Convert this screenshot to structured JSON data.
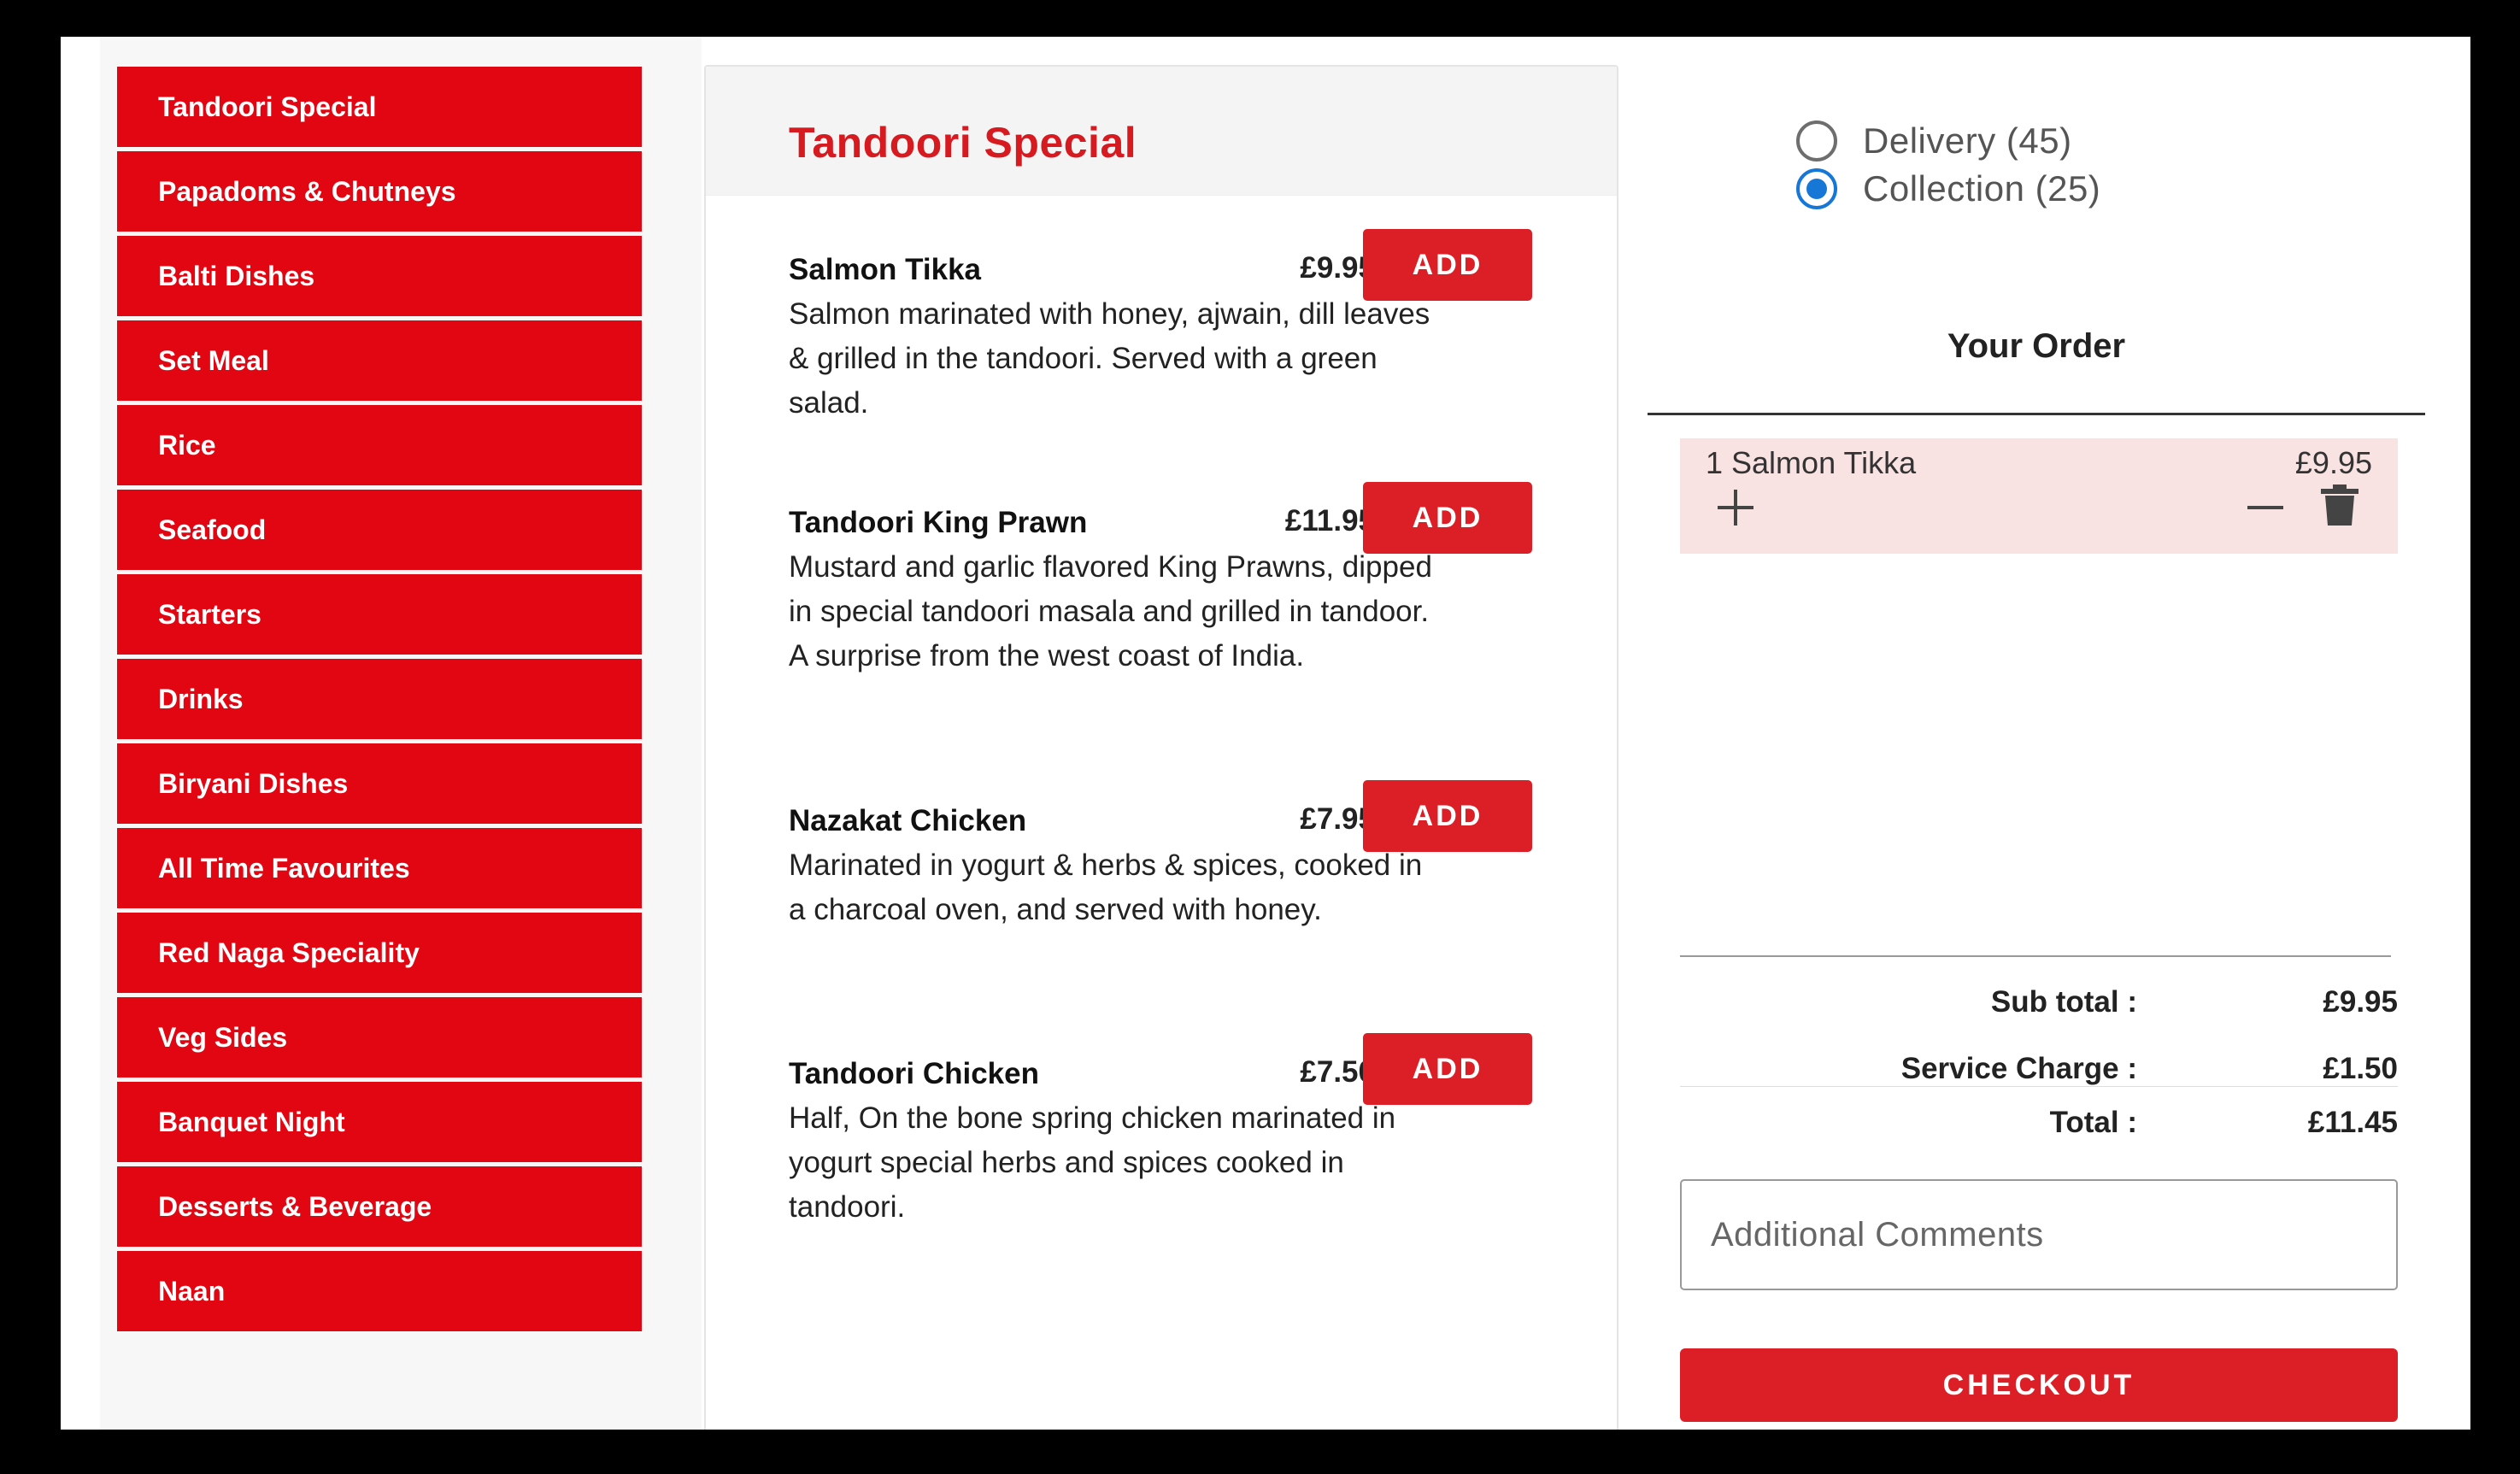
{
  "sidebar": {
    "categories": [
      "Tandoori Special",
      "Papadoms & Chutneys",
      "Balti Dishes",
      "Set Meal",
      "Rice",
      "Seafood",
      "Starters",
      "Drinks",
      "Biryani Dishes",
      "All Time Favourites",
      "Red Naga Speciality",
      "Veg Sides",
      "Banquet Night",
      "Desserts & Beverage",
      "Naan"
    ]
  },
  "menu": {
    "title": "Tandoori Special",
    "add_label": "ADD",
    "dishes": [
      {
        "name": "Salmon Tikka",
        "price": "£9.95",
        "description": "Salmon marinated with honey, ajwain, dill leaves & grilled in the tandoori. Served with a green salad."
      },
      {
        "name": "Tandoori King Prawn",
        "price": "£11.95",
        "description": "Mustard and garlic flavored King Prawns, dipped in special tandoori masala and grilled in tandoor. A surprise from the west coast of India."
      },
      {
        "name": "Nazakat Chicken",
        "price": "£7.95",
        "description": "Marinated in yogurt & herbs & spices, cooked in a charcoal oven, and served with honey."
      },
      {
        "name": "Tandoori Chicken",
        "price": "£7.50",
        "description": "Half, On the bone spring chicken marinated in yogurt special herbs and spices cooked in tandoori."
      }
    ]
  },
  "order_type": {
    "options": [
      {
        "label": "Delivery (45)",
        "selected": false
      },
      {
        "label": "Collection (25)",
        "selected": true
      }
    ]
  },
  "order": {
    "title": "Your Order",
    "items": [
      {
        "label": "1 Salmon Tikka",
        "price": "£9.95"
      }
    ],
    "icons": [
      "plus-icon",
      "minus-icon",
      "trash-icon"
    ],
    "sub_total_label": "Sub total :",
    "sub_total": "£9.95",
    "service_charge_label": "Service Charge :",
    "service_charge": "£1.50",
    "total_label": "Total :",
    "total": "£11.45",
    "comments_placeholder": "Additional Comments",
    "checkout_label": "CHECKOUT"
  },
  "colors": {
    "accent_red": "#e20613",
    "button_red": "#dc1e26",
    "radio_blue": "#1677d6",
    "order_item_bg": "#f9e2e2"
  }
}
